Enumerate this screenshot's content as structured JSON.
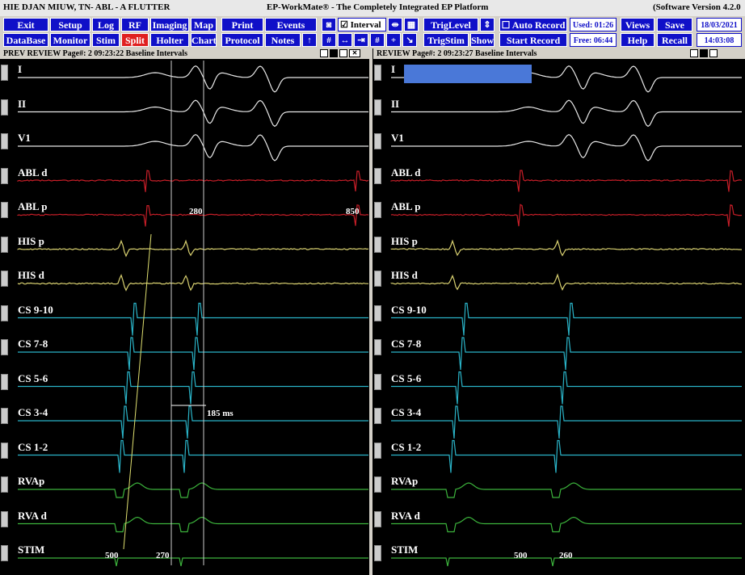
{
  "titlebar": {
    "patient": "HIE DJAN MIUW, TN",
    "procedure": "-  ABL - A FLUTTER",
    "app": "EP-WorkMate®  -  The Completely Integrated EP Platform",
    "version": "(Software Version 4.2.0"
  },
  "toolbar": {
    "row1": [
      "Exit",
      "Setup",
      "Log",
      "RF",
      "Imaging",
      "Map",
      "Print",
      "Events"
    ],
    "row2": [
      "DataBase",
      "Monitor",
      "Stim",
      "Split",
      "Holter",
      "Chart",
      "Protocol",
      "Notes"
    ],
    "interval_label": "Interval",
    "trig_level": "TrigLevel",
    "trig_stim": "TrigStim",
    "show": "Show",
    "auto_record": "Auto Record",
    "start_record": "Start Record",
    "used": "Used: 01:26",
    "free": "Free: 06:44",
    "views": "Views",
    "help": "Help",
    "save": "Save",
    "recall": "Recall",
    "date": "18/03/2021",
    "time": "14:03:08"
  },
  "left_panel": {
    "title": "PREV REVIEW Page#: 2   09:23:22    Baseline Intervals",
    "measurements": {
      "abl_280": "280",
      "abl_850": "850",
      "cs_185": "185 ms",
      "stim_500": "500",
      "stim_270": "270"
    }
  },
  "right_panel": {
    "title": "REVIEW Page#: 2   09:23:27    Baseline Intervals",
    "measurements": {
      "stim_500": "500",
      "stim_260": "260"
    }
  },
  "channels": [
    {
      "name": "I",
      "color": "#e8e8e8"
    },
    {
      "name": "II",
      "color": "#e8e8e8"
    },
    {
      "name": "V1",
      "color": "#e8e8e8"
    },
    {
      "name": "ABL d",
      "color": "#c81e28"
    },
    {
      "name": "ABL p",
      "color": "#c81e28"
    },
    {
      "name": "HIS p",
      "color": "#d8d070"
    },
    {
      "name": "HIS d",
      "color": "#d8d070"
    },
    {
      "name": "CS 9-10",
      "color": "#2ab4c8"
    },
    {
      "name": "CS 7-8",
      "color": "#2ab4c8"
    },
    {
      "name": "CS 5-6",
      "color": "#2ab4c8"
    },
    {
      "name": "CS 3-4",
      "color": "#2ab4c8"
    },
    {
      "name": "CS 1-2",
      "color": "#2ab4c8"
    },
    {
      "name": "RVAp",
      "color": "#3cb43c"
    },
    {
      "name": "RVA d",
      "color": "#3cb43c"
    },
    {
      "name": "STIM",
      "color": "#3cb43c"
    }
  ]
}
